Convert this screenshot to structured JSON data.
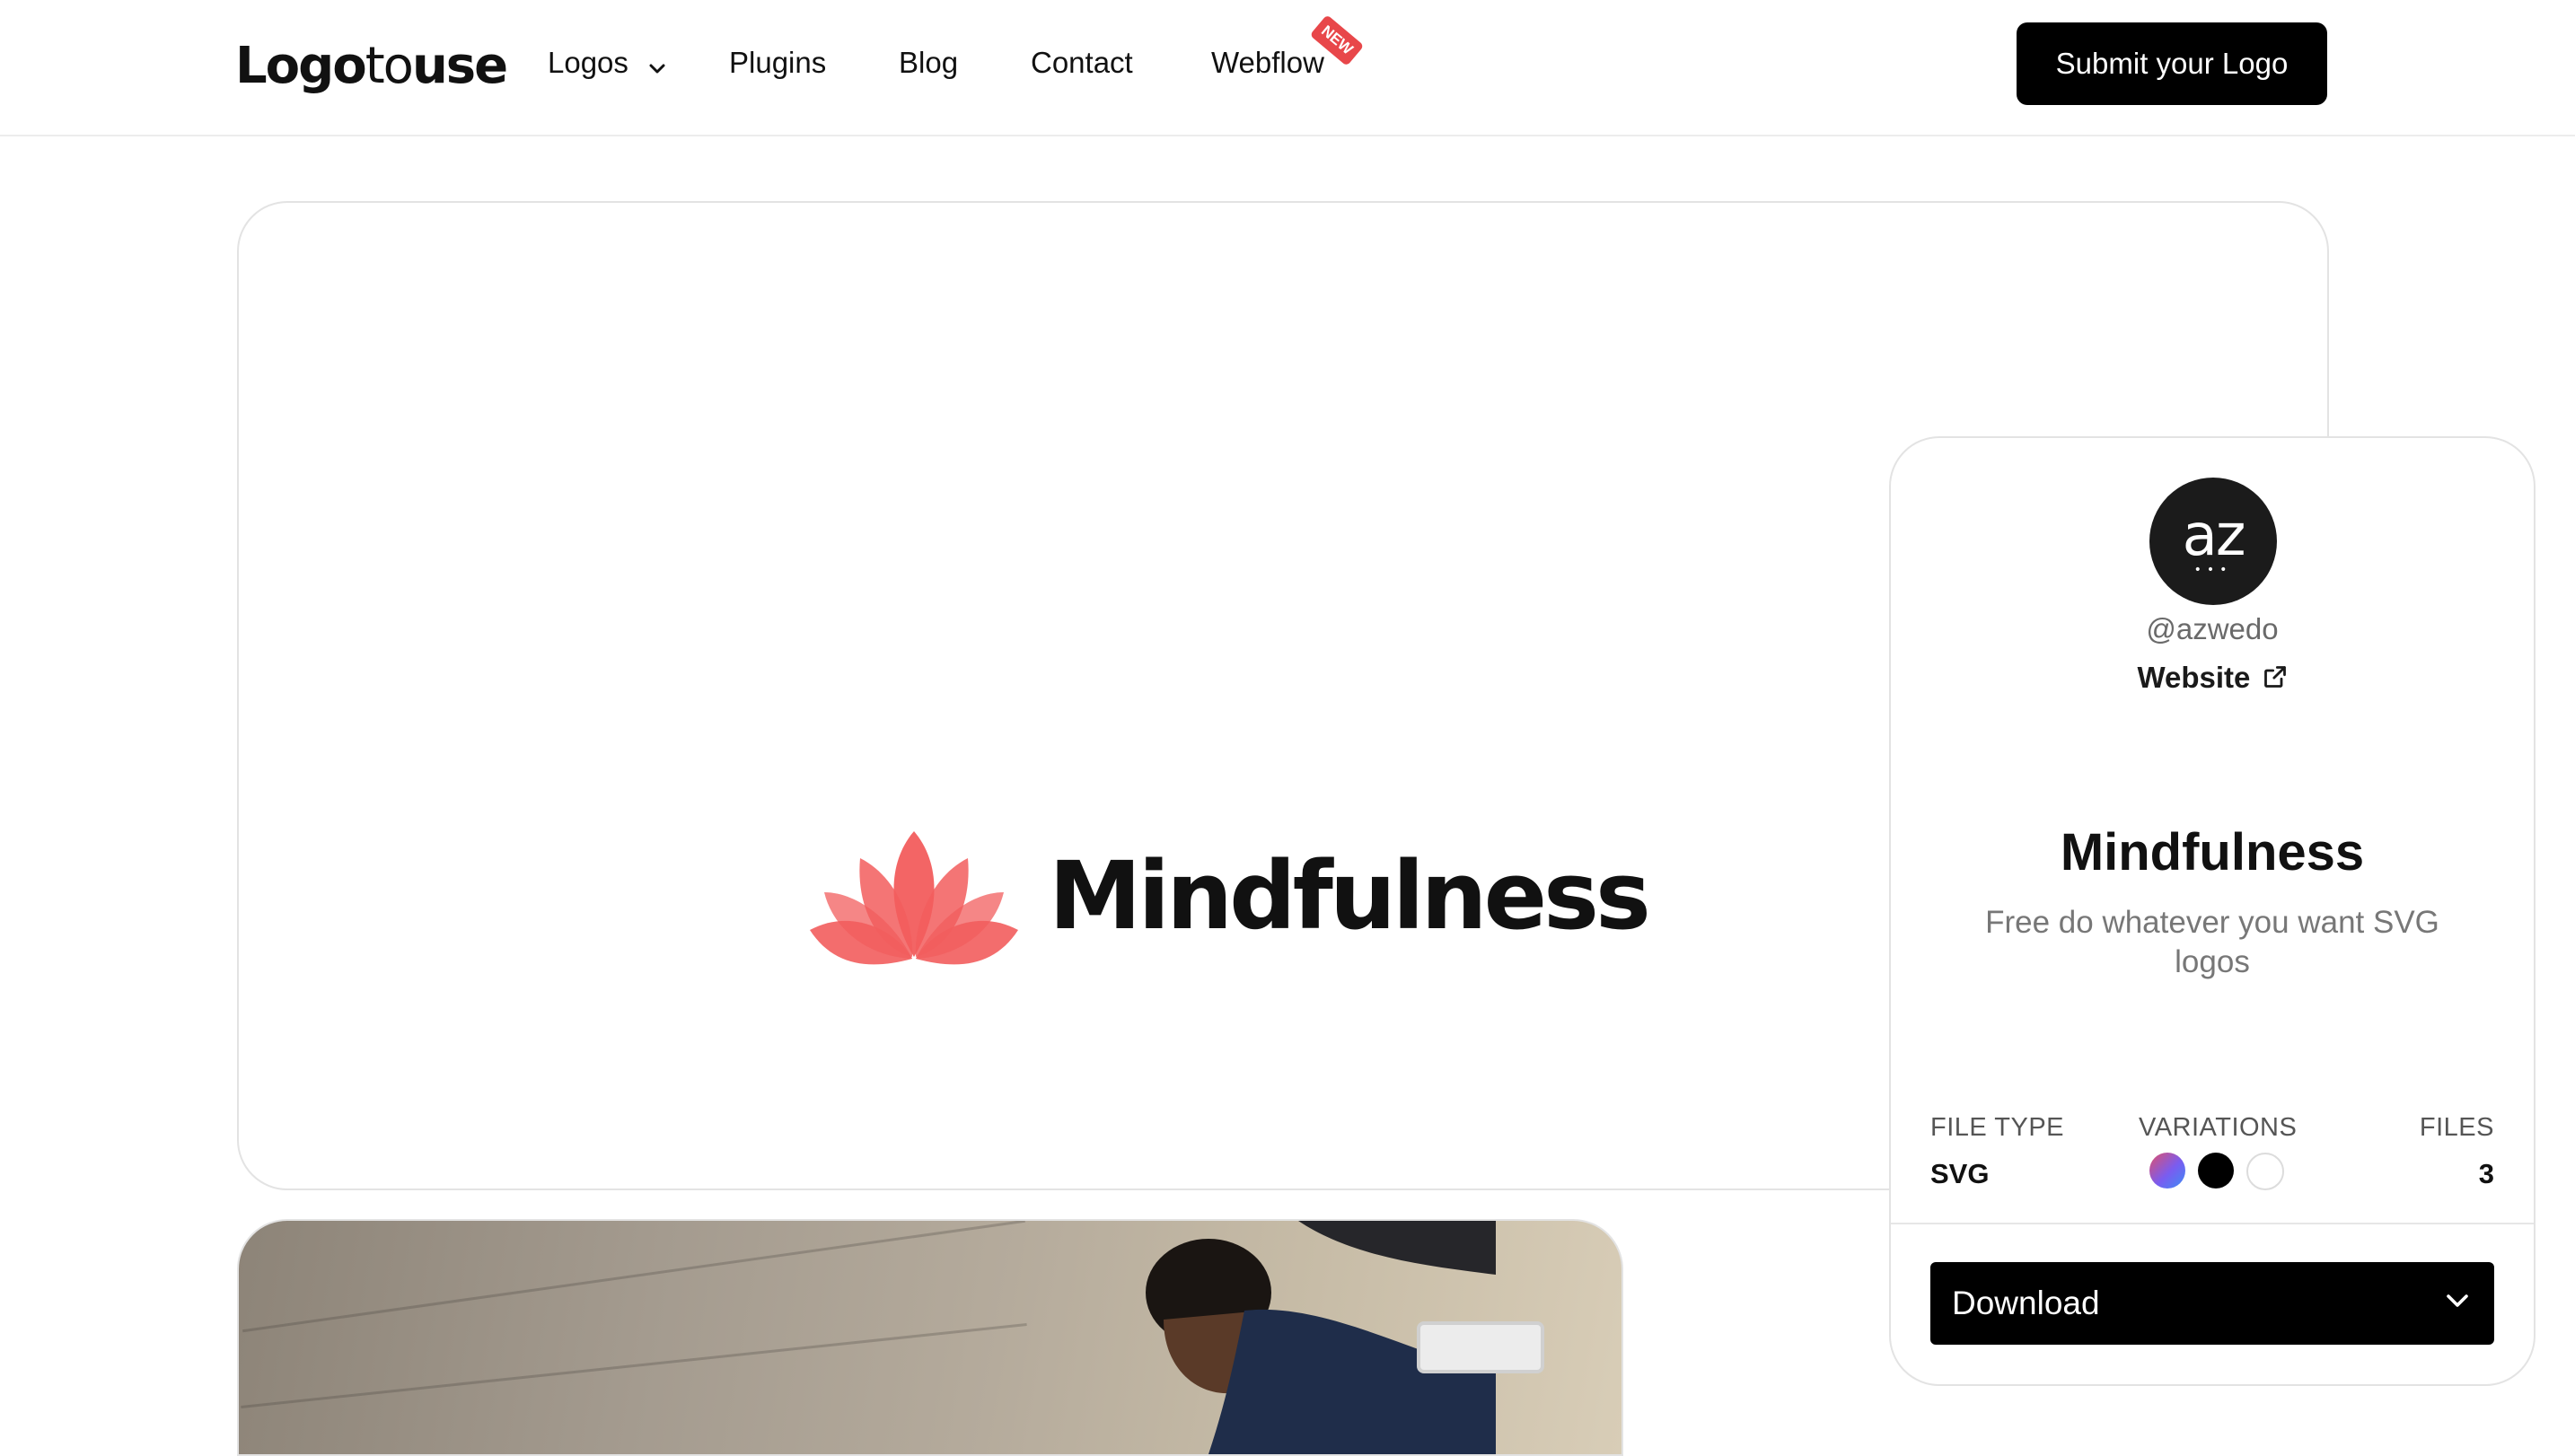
{
  "header": {
    "logo_part1": "Logo",
    "logo_part2": "to",
    "logo_part3": "use",
    "nav": [
      {
        "label": "Logos",
        "has_dropdown": true
      },
      {
        "label": "Plugins"
      },
      {
        "label": "Blog"
      },
      {
        "label": "Contact"
      },
      {
        "label": "Webflow",
        "badge": "NEW"
      }
    ],
    "submit_label": "Submit your Logo"
  },
  "preview": {
    "logo_text": "Mindfulness",
    "lotus_color": "#f25d5d"
  },
  "author": {
    "avatar_text": "az",
    "avatar_dots": "•••",
    "handle": "@azwedo",
    "website_label": "Website"
  },
  "details": {
    "title": "Mindfulness",
    "description": "Free do whatever you want SVG logos",
    "file_type_label": "FILE TYPE",
    "file_type_value": "SVG",
    "variations_label": "VARIATIONS",
    "variations": [
      "gradient",
      "#000000",
      "#ffffff"
    ],
    "files_label": "FILES",
    "files_value": "3"
  },
  "download": {
    "label": "Download"
  }
}
